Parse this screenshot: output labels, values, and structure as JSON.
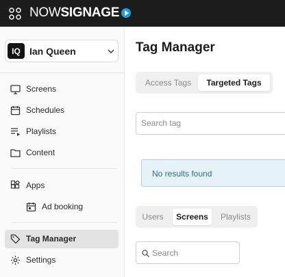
{
  "topbar": {
    "logo_light": "NOW",
    "logo_bold": "SIGNAGE",
    "icons": {
      "apps": "grid-icon",
      "logo_mark": "play-icon"
    }
  },
  "user": {
    "initials": "IQ",
    "name": "Ian Queen",
    "chevron": "chevron-down-icon"
  },
  "sidebar": {
    "items": [
      {
        "label": "Screens",
        "icon": "monitor-icon"
      },
      {
        "label": "Schedules",
        "icon": "calendar-icon"
      },
      {
        "label": "Playlists",
        "icon": "playlist-icon"
      },
      {
        "label": "Content",
        "icon": "folder-icon"
      },
      {
        "label": "Apps",
        "icon": "apps-icon"
      },
      {
        "label": "Ad booking",
        "icon": "calendar-icon"
      },
      {
        "label": "Tag Manager",
        "icon": "tag-icon",
        "active": true
      },
      {
        "label": "Settings",
        "icon": "gear-icon"
      }
    ]
  },
  "main": {
    "title": "Tag Manager",
    "tag_tabs": [
      {
        "label": "Access Tags",
        "active": false
      },
      {
        "label": "Targeted Tags",
        "active": true
      }
    ],
    "tag_search_placeholder": "Search tag",
    "no_results": "No results found",
    "entity_tabs": [
      {
        "label": "Users",
        "active": false
      },
      {
        "label": "Screens",
        "active": true
      },
      {
        "label": "Playlists",
        "active": false
      }
    ],
    "search_placeholder": "Search"
  },
  "colors": {
    "topbar_bg": "#1c1c1c",
    "brand_accent": "#1aa0e0",
    "alert_bg": "#e6f3f8",
    "alert_border": "#a7d3e4",
    "alert_text": "#2a6f8f",
    "active_nav_bg": "#e3e3e3"
  }
}
